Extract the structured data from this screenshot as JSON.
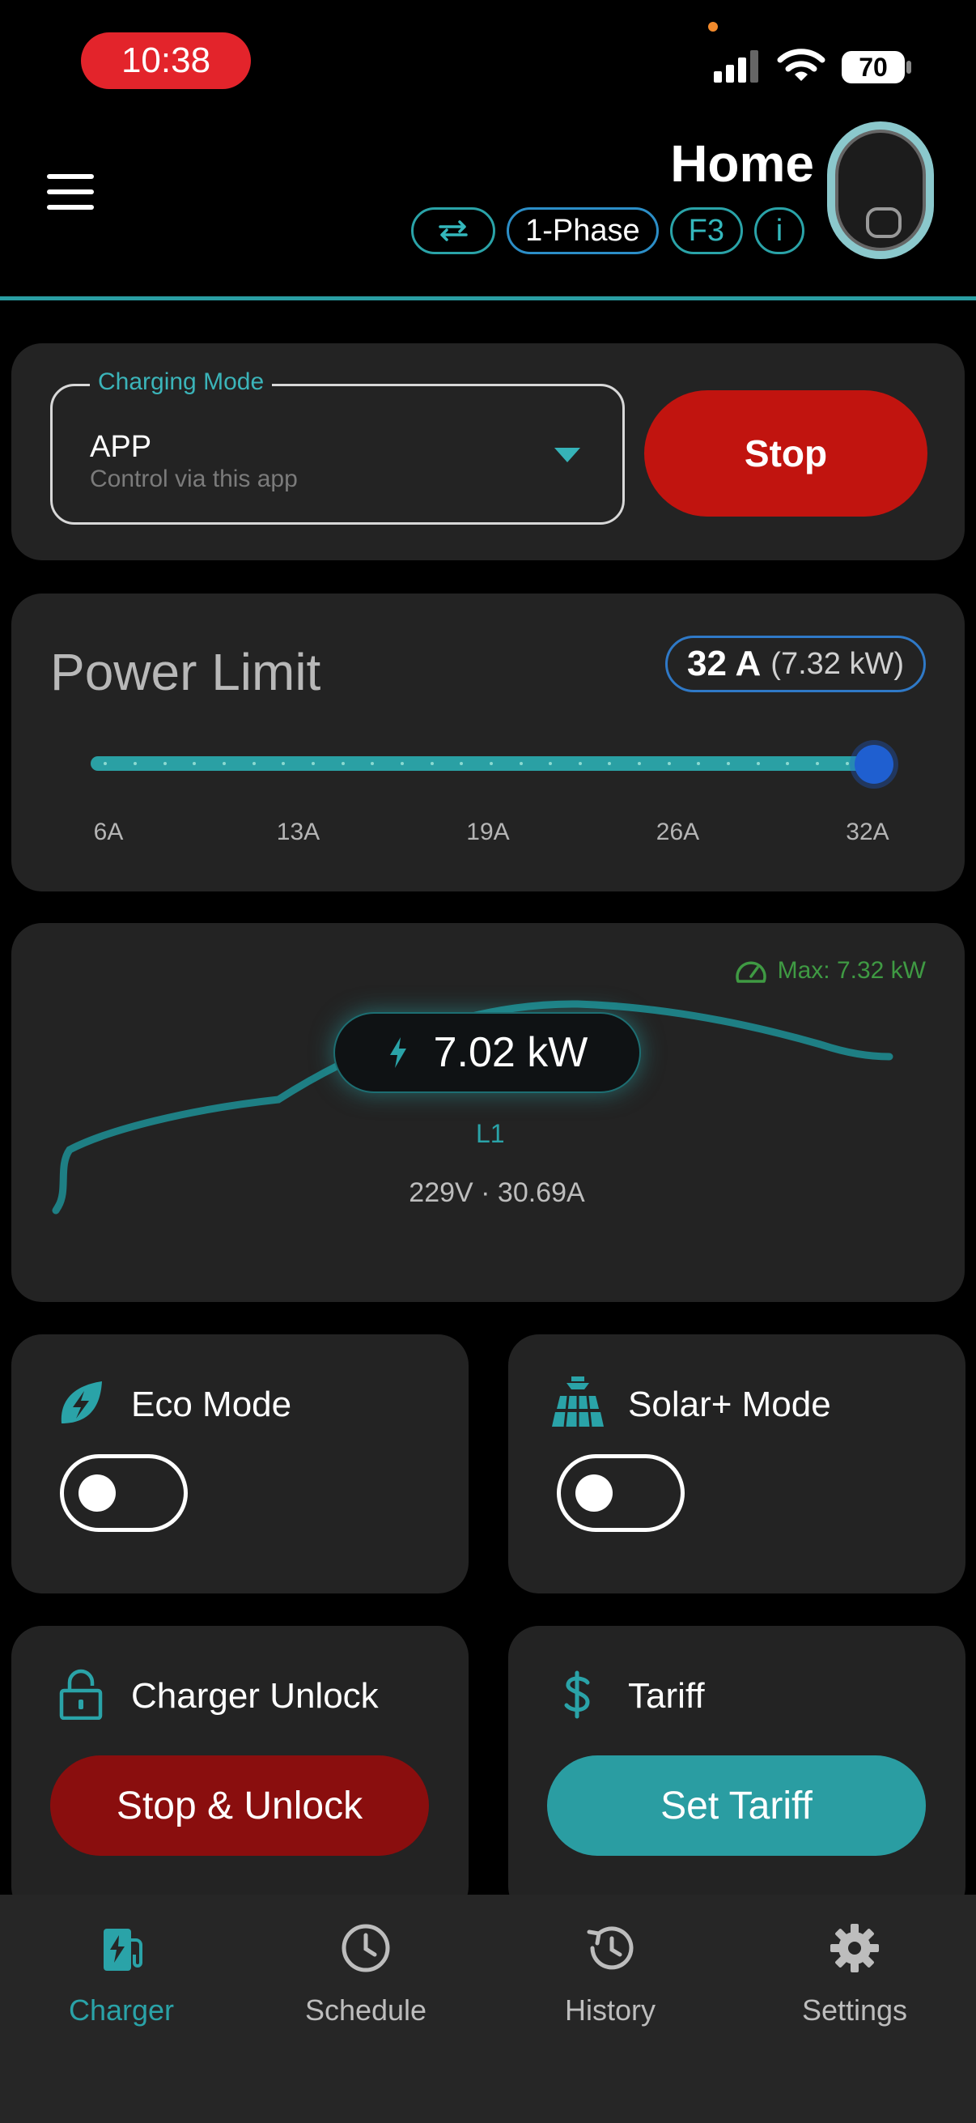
{
  "status_bar": {
    "time": "10:38",
    "battery": "70"
  },
  "header": {
    "title": "Home",
    "chips": {
      "phase": "1-Phase",
      "fault": "F3",
      "info": "i"
    }
  },
  "charging_mode": {
    "legend": "Charging Mode",
    "value": "APP",
    "description": "Control via this app",
    "stop_label": "Stop"
  },
  "power_limit": {
    "title": "Power Limit",
    "current_amps": "32 A",
    "current_kw": "(7.32 kW)",
    "slider_fraction": 1.0,
    "ticks": [
      "6A",
      "13A",
      "19A",
      "26A",
      "32A"
    ]
  },
  "live_power": {
    "max_label": "Max: 7.32 kW",
    "value": "7.02 kW",
    "phase": "L1",
    "detail": "229V · 30.69A"
  },
  "eco_mode": {
    "label": "Eco Mode",
    "enabled": false
  },
  "solar_mode": {
    "label": "Solar+ Mode",
    "enabled": false
  },
  "charger_unlock": {
    "label": "Charger Unlock",
    "button": "Stop & Unlock"
  },
  "tariff": {
    "label": "Tariff",
    "button": "Set Tariff"
  },
  "nav": {
    "items": [
      {
        "label": "Charger",
        "icon": "charger-icon",
        "active": true
      },
      {
        "label": "Schedule",
        "icon": "clock-icon",
        "active": false
      },
      {
        "label": "History",
        "icon": "history-icon",
        "active": false
      },
      {
        "label": "Settings",
        "icon": "gear-icon",
        "active": false
      }
    ]
  },
  "colors": {
    "accent": "#2aa3a8",
    "stop": "#c1140f",
    "unlock": "#8a0e0e",
    "card": "#232323",
    "max_label": "#3f9a43"
  }
}
